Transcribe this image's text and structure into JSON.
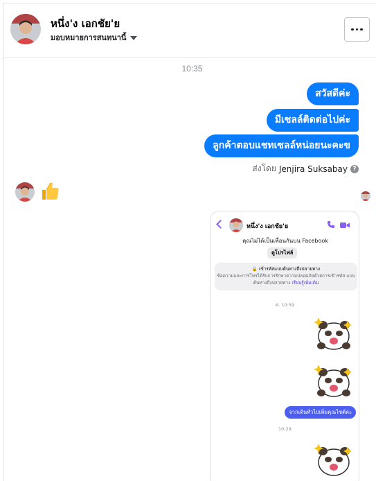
{
  "header": {
    "contact_name": "หนึ่ง'ง เอกชัย'ย",
    "assign_label": "มอบหมายการสนทนานี้",
    "more_label": "…"
  },
  "conversation": {
    "timestamp": "10:35",
    "messages": [
      {
        "text": "สวัสดีค่ะ"
      },
      {
        "text": "มีเซลล์ติดต่อไปค่ะ"
      },
      {
        "text": "ลูกค้าตอบแชทเซลล์หน่อยนะคะข"
      }
    ],
    "sent_by_prefix": "ส่งโดย",
    "sent_by_agent": "Jenjira Suksabay",
    "help_glyph": "?",
    "incoming_icon": "thumbs-up-icon"
  },
  "embedded_screenshot": {
    "contact_name": "หนึ่ง'ง เอกชัย'ย",
    "subtitle": "คุณไม่ได้เป็นเพื่อนกันบน Facebook",
    "profile_button": "ดูโปรไฟล์",
    "e2e_title": "🔒 เข้ารหัสแบบต้นทางถึงปลายทาง",
    "e2e_body": "ข้อความและการโทรได้รับการรักษาความปลอดภัยด้วยการเข้ารหัส แบบต้นทางถึงปลายทาง",
    "e2e_link": "เรียนรู้เพิ่มเติม",
    "time_1": "ศ. 10:59",
    "message": "จากเดินทั่วไปเพิ่มคุณไซต์ค่ะ",
    "time_2": "10:29"
  },
  "colors": {
    "bubble": "#0a7cff",
    "accent_purple": "#8b5cf6",
    "embedded_bubble": "#4b5ef0"
  }
}
